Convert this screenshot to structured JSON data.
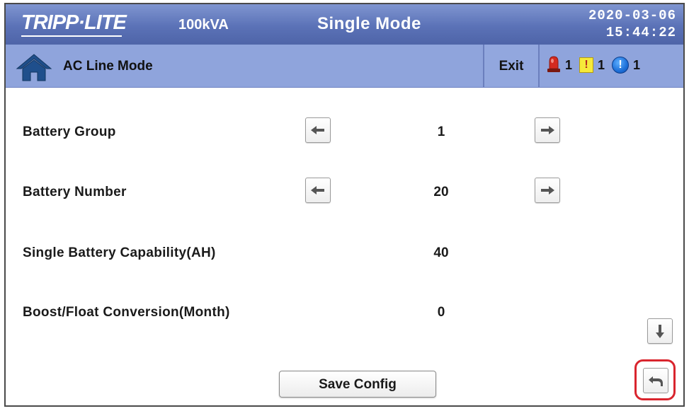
{
  "header": {
    "logo_text": "TRIPP·LITE",
    "capacity": "100kVA",
    "mode": "Single Mode",
    "date": "2020-03-06",
    "time": "15:44:22"
  },
  "subbar": {
    "status": "AC Line Mode",
    "exit_label": "Exit",
    "alarms": [
      {
        "icon": "siren-icon",
        "count": "1"
      },
      {
        "icon": "warning-icon",
        "glyph": "!",
        "count": "1"
      },
      {
        "icon": "info-icon",
        "glyph": "!",
        "count": "1"
      }
    ]
  },
  "settings": [
    {
      "label": "Battery Group",
      "value": "1",
      "adjustable": true
    },
    {
      "label": "Battery Number",
      "value": "20",
      "adjustable": true
    },
    {
      "label": "Single Battery Capability(AH)",
      "value": "40",
      "adjustable": false
    },
    {
      "label": "Boost/Float Conversion(Month)",
      "value": "0",
      "adjustable": false
    }
  ],
  "actions": {
    "save_label": "Save Config",
    "scroll_down_icon": "arrow-down-icon",
    "back_icon": "return-arrow-icon"
  },
  "colors": {
    "header_bg": "#5b72b7",
    "subbar_bg": "#8fa4dc",
    "highlight": "#d9252e",
    "warning": "#f6ea3a",
    "info": "#1d6fd8",
    "siren": "#d42a1f"
  }
}
